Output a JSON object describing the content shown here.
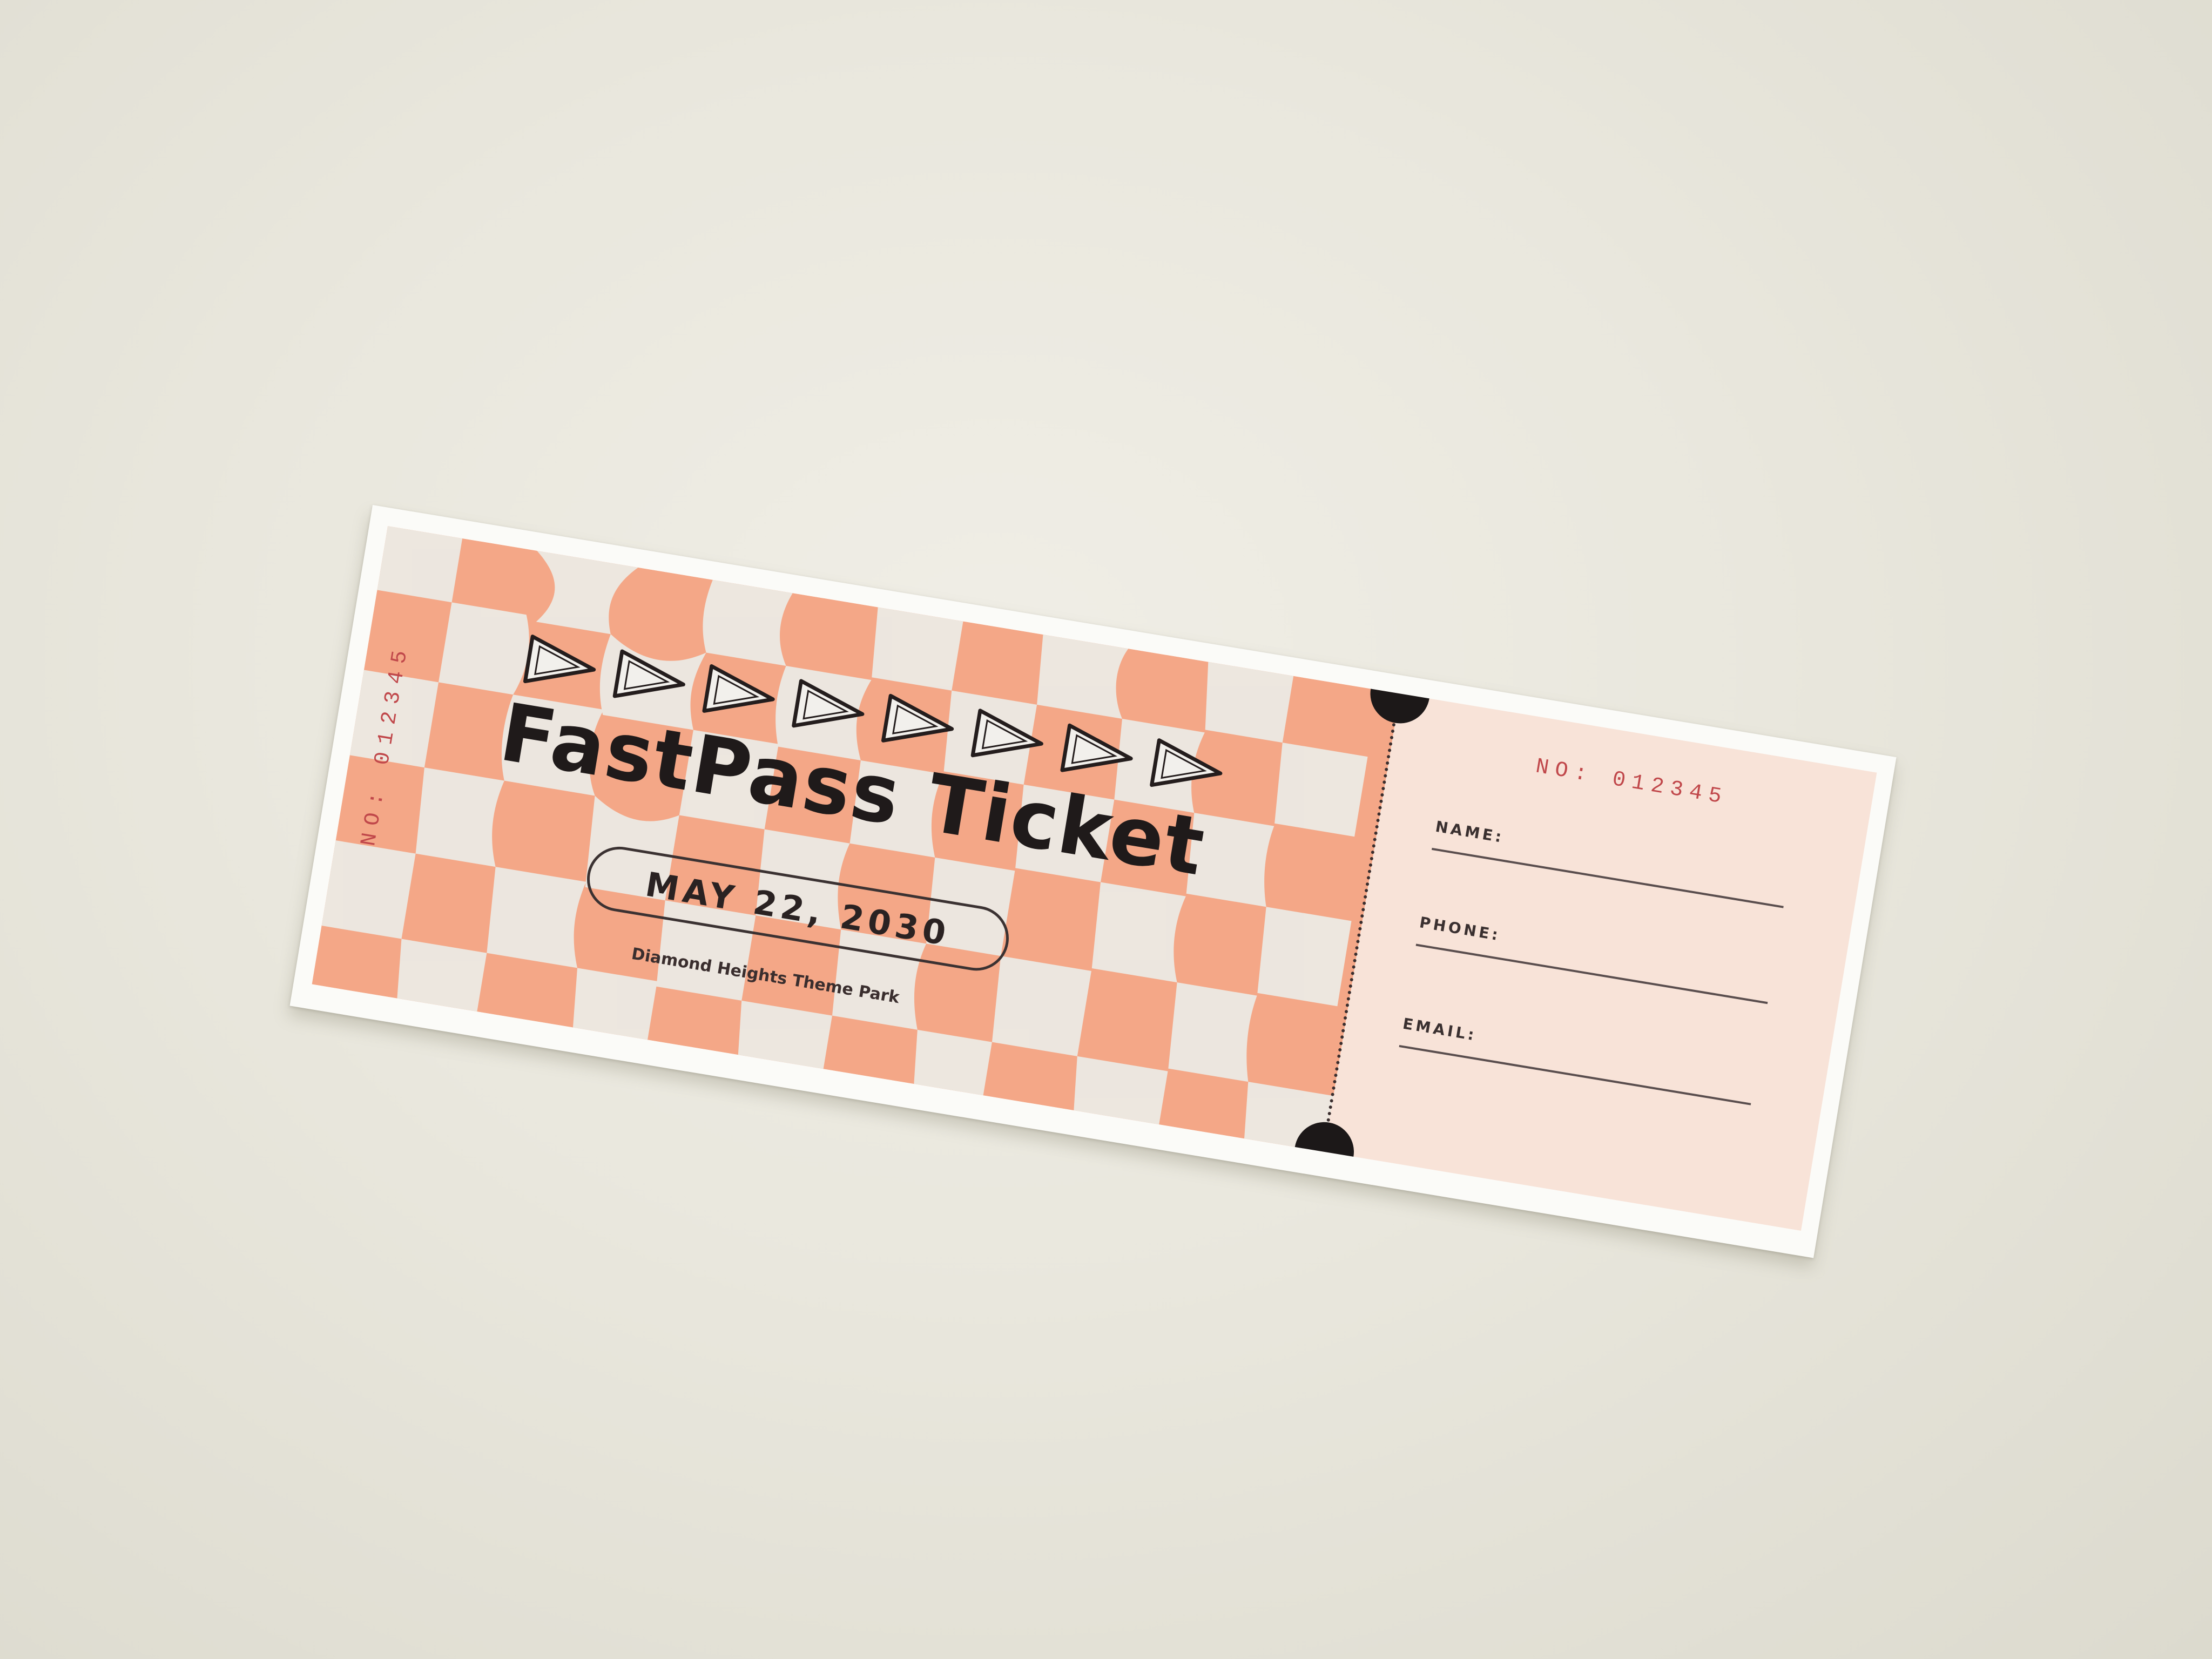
{
  "ticket": {
    "serial_side": "NO: 012345",
    "title": "FastPass Ticket",
    "date": "MAY 22, 2030",
    "venue": "Diamond Heights Theme Park",
    "arrow_count": 8,
    "colors": {
      "peach": "#f4a787",
      "cream": "#eceae4",
      "stub": "#f8e3d8",
      "ink": "#1f1a1a",
      "serial_red": "#c0474a"
    }
  },
  "stub": {
    "serial": "NO: 012345",
    "fields": [
      {
        "label": "NAME:"
      },
      {
        "label": "PHONE:"
      },
      {
        "label": "EMAIL:"
      }
    ]
  }
}
